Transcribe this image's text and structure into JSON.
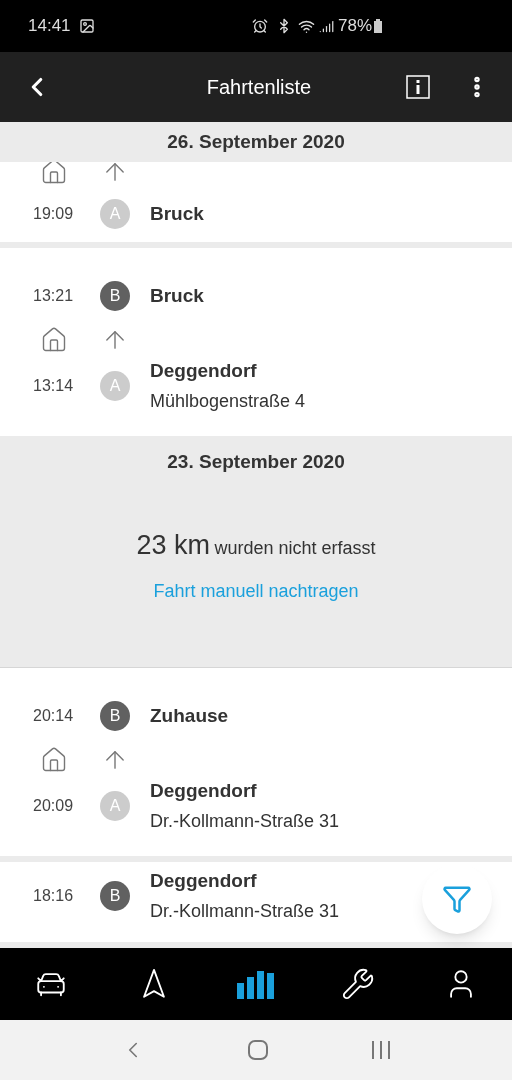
{
  "status_bar": {
    "time": "14:41",
    "battery": "78%"
  },
  "header": {
    "title": "Fahrtenliste"
  },
  "sections": [
    {
      "kind": "date",
      "label": "26. September 2020"
    },
    {
      "kind": "trip",
      "cut_top": true,
      "stops": [
        {
          "kind": "origin",
          "letter": "A",
          "time": "19:09",
          "place": "Bruck"
        }
      ]
    },
    {
      "kind": "trip",
      "stops": [
        {
          "kind": "destination",
          "letter": "B",
          "time": "13:21",
          "place": "Bruck"
        },
        {
          "kind": "origin",
          "letter": "A",
          "time": "13:14",
          "place": "Deggendorf",
          "address": "Mühlbogenstraße 4"
        }
      ]
    },
    {
      "kind": "date",
      "label": "23. September 2020"
    },
    {
      "kind": "untracked",
      "distance": "23 km",
      "text": "wurden nicht erfasst",
      "link": "Fahrt manuell nachtragen"
    },
    {
      "kind": "trip",
      "stops": [
        {
          "kind": "destination",
          "letter": "B",
          "time": "20:14",
          "place": "Zuhause"
        },
        {
          "kind": "origin",
          "letter": "A",
          "time": "20:09",
          "place": "Deggendorf",
          "address": "Dr.-Kollmann-Straße 31"
        }
      ]
    },
    {
      "kind": "trip",
      "cut_bottom": true,
      "stops": [
        {
          "kind": "destination",
          "letter": "B",
          "time": "18:16",
          "place": "Deggendorf",
          "address": "Dr.-Kollmann-Straße 31"
        }
      ]
    }
  ],
  "nav": [
    {
      "kind": "car",
      "selected": false
    },
    {
      "kind": "navigate",
      "selected": false
    },
    {
      "kind": "stats",
      "selected": true
    },
    {
      "kind": "service",
      "selected": false
    },
    {
      "kind": "profile",
      "selected": false
    }
  ]
}
